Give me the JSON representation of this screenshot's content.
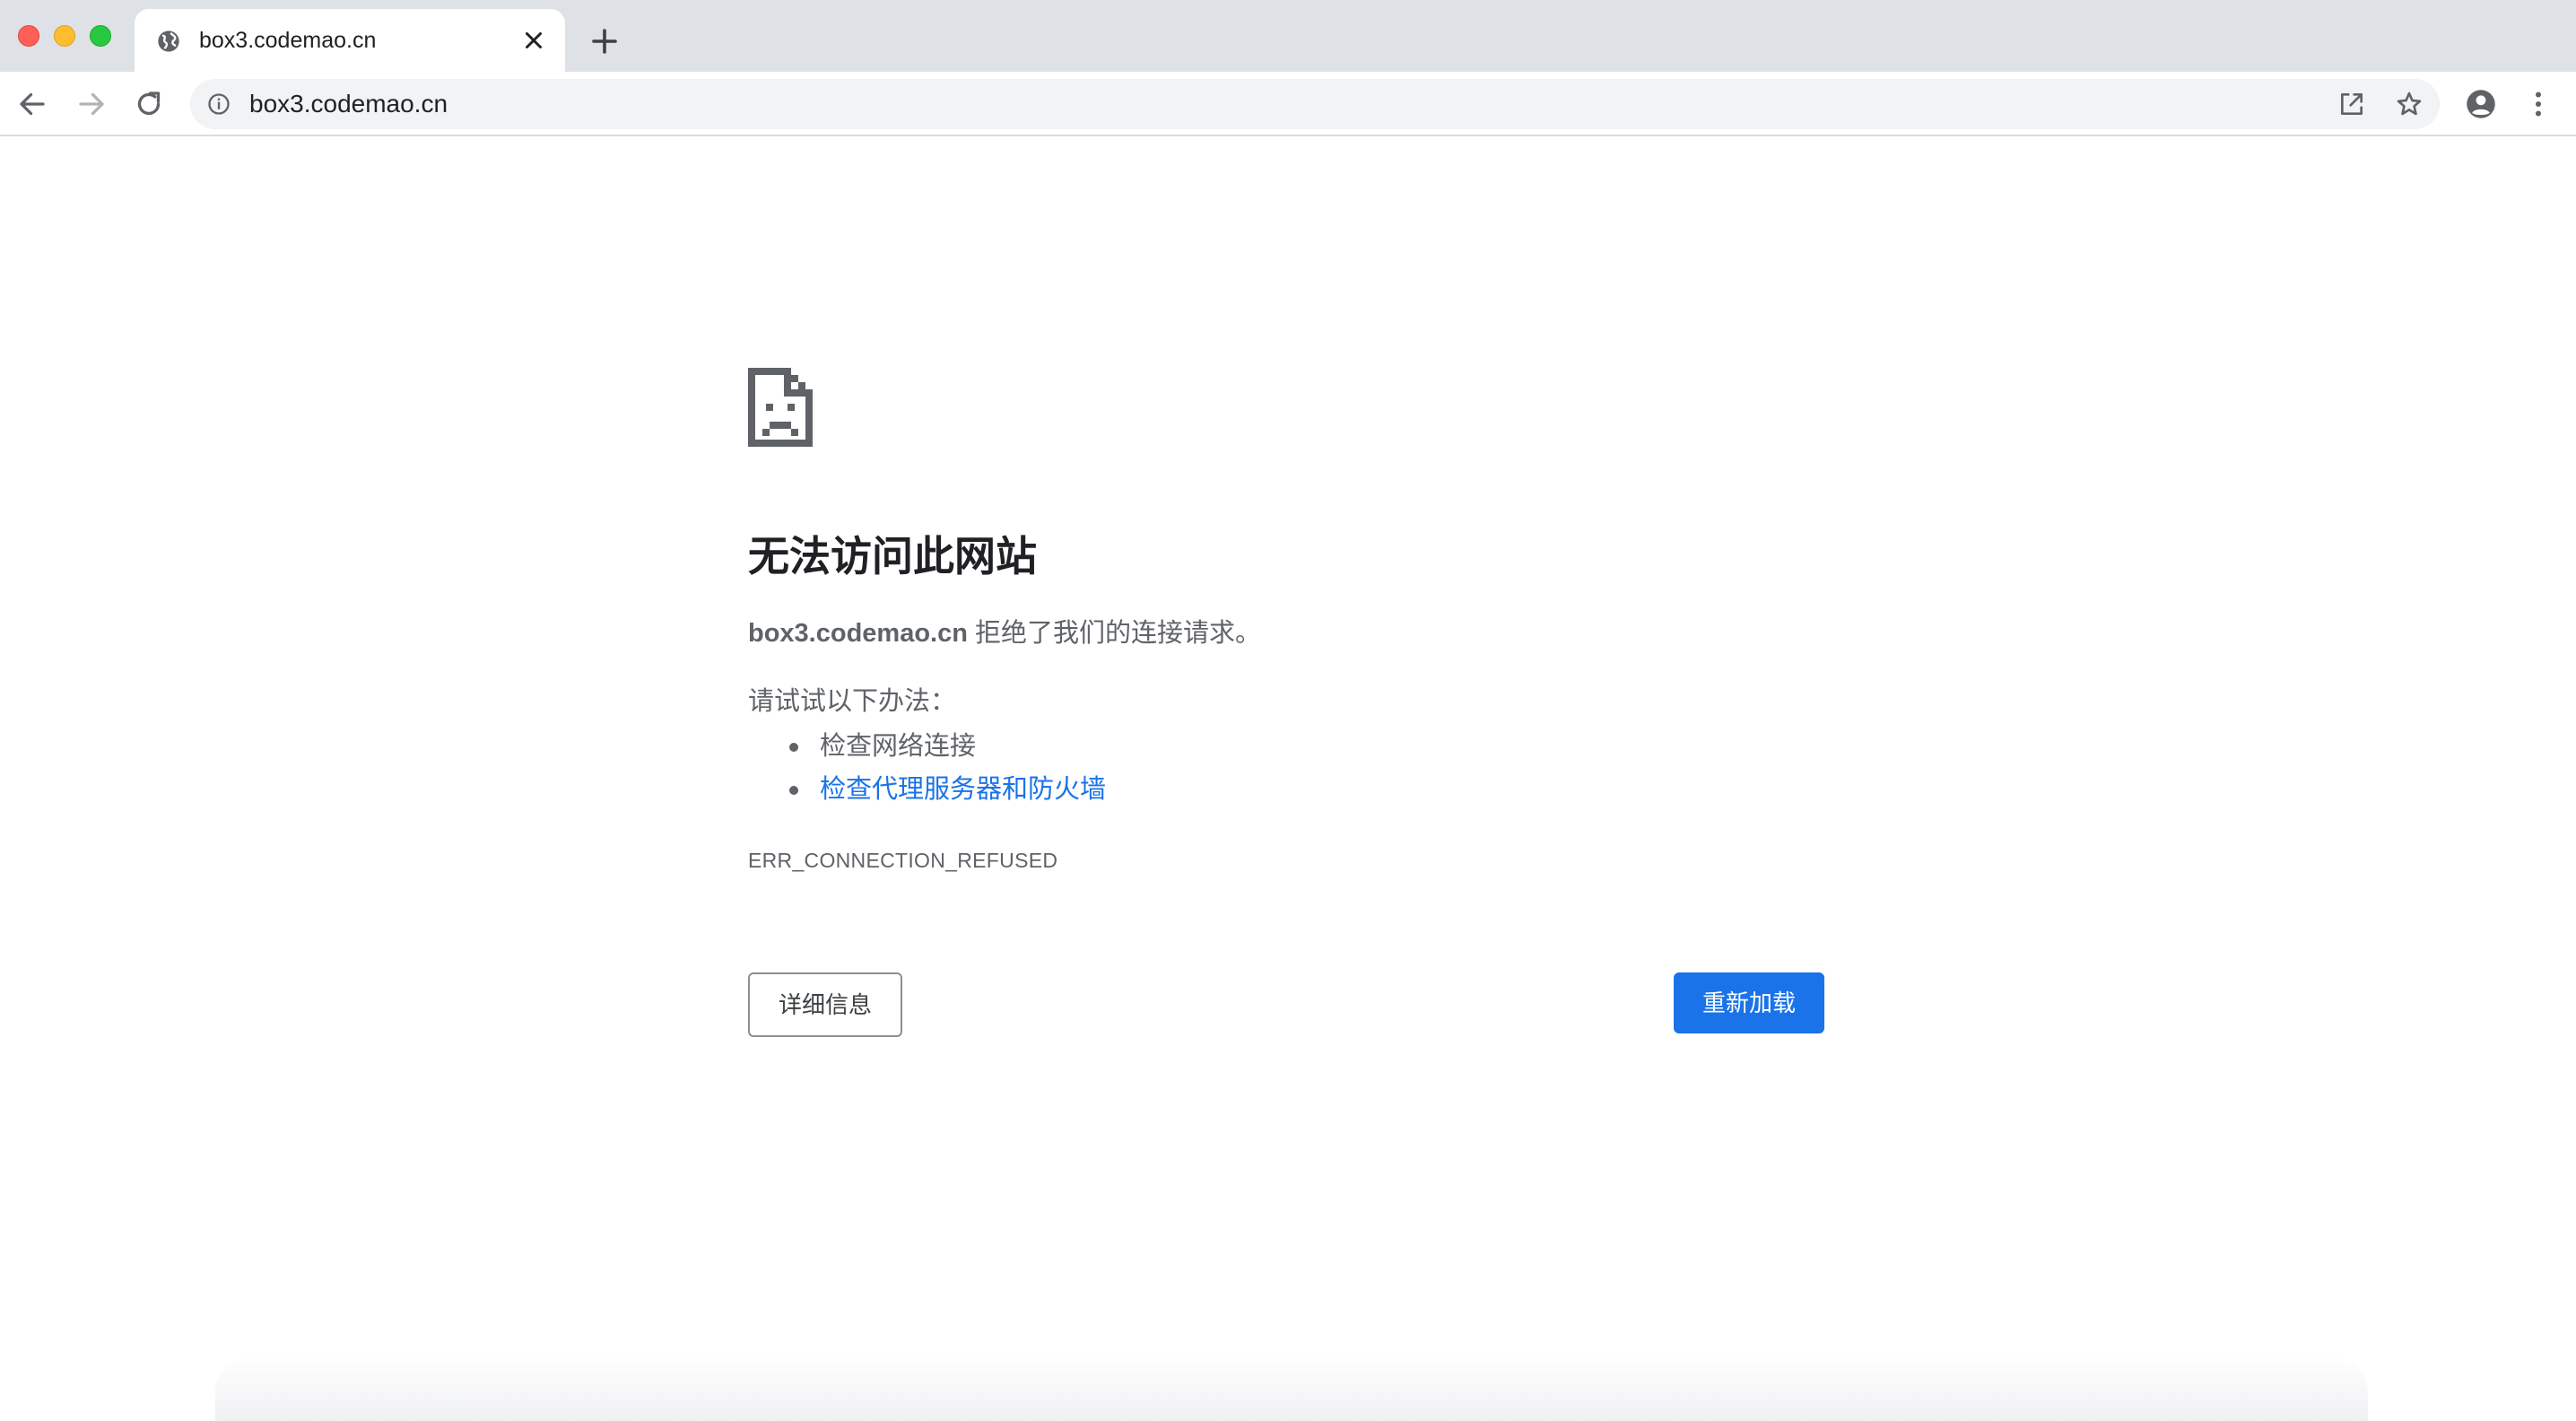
{
  "tab": {
    "title": "box3.codemao.cn",
    "favicon": "globe-icon"
  },
  "toolbar": {
    "url": "box3.codemao.cn"
  },
  "error": {
    "title": "无法访问此网站",
    "host": "box3.codemao.cn",
    "description": " 拒绝了我们的连接请求。",
    "suggestions_heading": "请试试以下办法：",
    "suggestions": [
      {
        "label": "检查网络连接",
        "is_link": false
      },
      {
        "label": "检查代理服务器和防火墙",
        "is_link": true
      }
    ],
    "code": "ERR_CONNECTION_REFUSED"
  },
  "buttons": {
    "details_label": "详细信息",
    "reload_label": "重新加载"
  },
  "colors": {
    "accent": "#1a73e8",
    "tabstrip": "#dee1e6",
    "text_primary": "#202124",
    "text_secondary": "#5f6368"
  }
}
